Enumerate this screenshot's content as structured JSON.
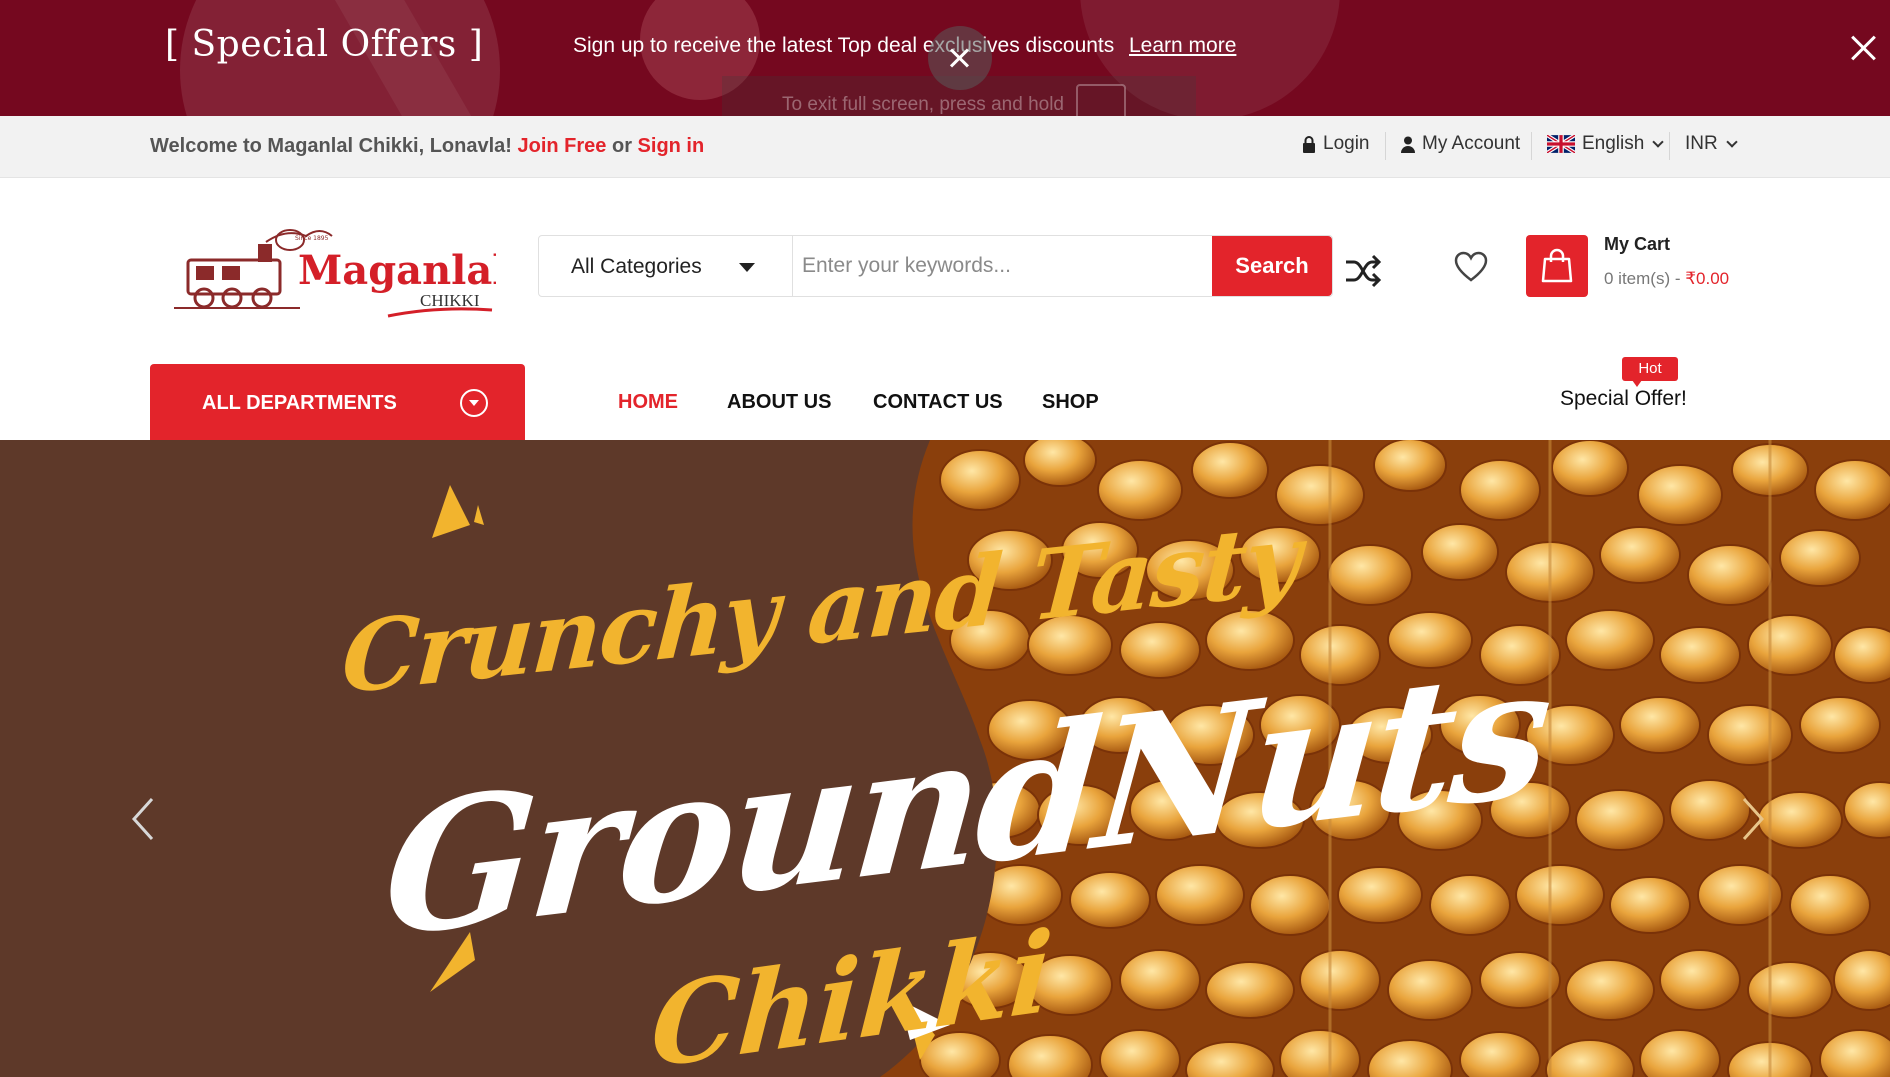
{
  "colors": {
    "brand_red": "#e3242b",
    "promo_bg": "#75081f",
    "banner_bg": "#5e3929",
    "banner_yellow": "#f2b42e"
  },
  "promo": {
    "title": "[ Special Offers ]",
    "text": "Sign up to receive the latest Top deal exclusives discounts",
    "link": "Learn more",
    "close_icon": "close-icon"
  },
  "fullscreen_hint": "To exit full screen, press and hold",
  "topbar": {
    "welcome": "Welcome to Maganlal Chikki, Lonavla!",
    "join": "Join Free",
    "or": "or",
    "signin": "Sign in",
    "login": "Login",
    "account": "My Account",
    "language": "English",
    "currency": "INR"
  },
  "header": {
    "logo_text": "Maganlal",
    "logo_sub": "CHIKKI",
    "logo_since": "Since 1895",
    "category": "All Categories",
    "search_placeholder": "Enter your keywords...",
    "search_label": "Search",
    "cart_title": "My Cart",
    "cart_items": "0 item(s) -",
    "cart_price": "₹0.00"
  },
  "nav": {
    "departments": "ALL DEPARTMENTS",
    "items": [
      "HOME",
      "ABOUT US",
      "CONTACT US",
      "SHOP"
    ],
    "hot_badge": "Hot",
    "special": "Special Offer!"
  },
  "banner": {
    "line1": "Crunchy and Tasty",
    "line2": "GroundNuts",
    "line3": "Chikki"
  }
}
